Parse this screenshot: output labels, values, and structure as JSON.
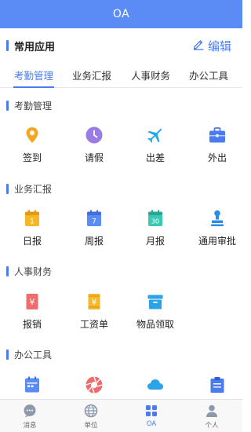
{
  "header": {
    "title": "OA"
  },
  "common": {
    "label": "常用应用",
    "edit_label": "编辑"
  },
  "tabs": [
    {
      "label": "考勤管理"
    },
    {
      "label": "业务汇报"
    },
    {
      "label": "人事财务"
    },
    {
      "label": "办公工具"
    }
  ],
  "sections": {
    "attendance": {
      "title": "考勤管理",
      "items": [
        {
          "label": "签到",
          "icon": "location-pin-icon",
          "color": "#f5a623"
        },
        {
          "label": "请假",
          "icon": "clock-icon",
          "color": "#9b7be6"
        },
        {
          "label": "出差",
          "icon": "airplane-icon",
          "color": "#29a7e1"
        },
        {
          "label": "外出",
          "icon": "briefcase-icon",
          "color": "#4a7cf0"
        }
      ]
    },
    "report": {
      "title": "业务汇报",
      "items": [
        {
          "label": "日报",
          "icon": "calendar-day-icon",
          "day": "1",
          "color": "#f5b828"
        },
        {
          "label": "周报",
          "icon": "calendar-week-icon",
          "day": "7",
          "color": "#5b8cf6"
        },
        {
          "label": "月报",
          "icon": "calendar-month-icon",
          "day": "30",
          "color": "#3cc9b4"
        },
        {
          "label": "通用审批",
          "icon": "stamp-icon",
          "color": "#2a8ee8"
        }
      ]
    },
    "hr": {
      "title": "人事财务",
      "items": [
        {
          "label": "报销",
          "icon": "yen-receipt-icon",
          "symbol": "¥",
          "color": "#f06b6b"
        },
        {
          "label": "工资单",
          "icon": "yen-wallet-icon",
          "symbol": "¥",
          "color": "#f5b828"
        },
        {
          "label": "物品领取",
          "icon": "archive-box-icon",
          "color": "#2aa3e8"
        }
      ]
    },
    "tools": {
      "title": "办公工具",
      "items": [
        {
          "icon": "calendar-icon",
          "color": "#5b8cf6"
        },
        {
          "icon": "aperture-icon",
          "color": "#f06b6b"
        },
        {
          "icon": "cloud-icon",
          "color": "#2aa3e8"
        },
        {
          "icon": "clipboard-icon",
          "color": "#4a7cf0"
        }
      ]
    }
  },
  "bottom_nav": [
    {
      "label": "消息",
      "icon": "chat-bubble-icon"
    },
    {
      "label": "单位",
      "icon": "globe-icon"
    },
    {
      "label": "OA",
      "icon": "grid-icon",
      "active": true
    },
    {
      "label": "个人",
      "icon": "person-icon"
    }
  ]
}
